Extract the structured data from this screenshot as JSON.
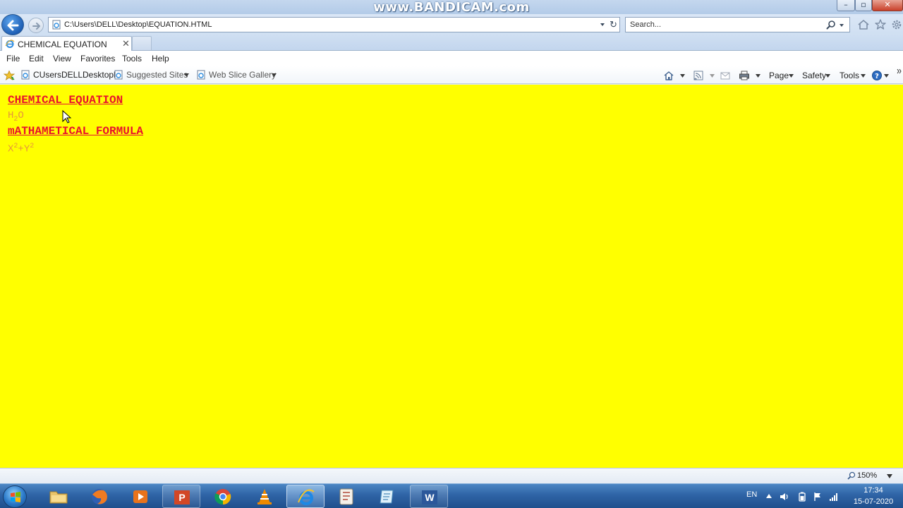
{
  "window": {
    "watermark": "www.BANDICAM.com",
    "min_glyph": "–",
    "max_glyph": "▫",
    "close_glyph": "✕"
  },
  "address_bar": {
    "url": "C:\\Users\\DELL\\Desktop\\EQUATION.HTML",
    "refresh_glyph": "↻"
  },
  "search": {
    "placeholder": "Search..."
  },
  "tab": {
    "title": "CHEMICAL EQUATION",
    "close_glyph": "✕"
  },
  "menu": {
    "file": "File",
    "edit": "Edit",
    "view": "View",
    "favorites": "Favorites",
    "tools": "Tools",
    "help": "Help"
  },
  "favorites_bar": {
    "items": [
      {
        "label": "CUsersDELLDesktoph"
      },
      {
        "label": "Suggested Sites"
      },
      {
        "label": "Web Slice Gallery"
      }
    ]
  },
  "command_bar": {
    "page": "Page",
    "safety": "Safety",
    "tools": "Tools"
  },
  "document": {
    "chem_heading": "CHEMICAL EQUATION",
    "chem_formula": {
      "base1": "H",
      "sub": "2",
      "base2": "O"
    },
    "math_heading": "mATHAMETICAL FORMULA",
    "math_formula": {
      "base1": "X",
      "sup1": "2",
      "plus": "+",
      "base2": "Y",
      "sup2": "2"
    }
  },
  "colors": {
    "page_background": "#ffff00",
    "heading": "#e8112d",
    "formula": "#e7963b"
  },
  "status_bar": {
    "zoom": "150%"
  },
  "taskbar": {
    "language": "EN",
    "time": "17:34",
    "date": "15-07-2020"
  }
}
